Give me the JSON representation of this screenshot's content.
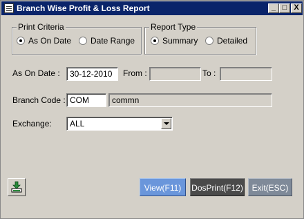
{
  "window": {
    "title": "Branch Wise Profit & Loss Report",
    "minimize": "_",
    "maximize": "□",
    "close": "X"
  },
  "print_criteria": {
    "legend": "Print Criteria",
    "options": [
      {
        "label": "As On Date",
        "selected": true
      },
      {
        "label": "Date Range",
        "selected": false
      }
    ]
  },
  "report_type": {
    "legend": "Report Type",
    "options": [
      {
        "label": "Summary",
        "selected": true
      },
      {
        "label": "Detailed",
        "selected": false
      }
    ]
  },
  "as_on_date": {
    "label": "As On Date :",
    "value": "30-12-2010"
  },
  "from": {
    "label": "From :",
    "value": ""
  },
  "to": {
    "label": "To :",
    "value": ""
  },
  "branch": {
    "label": "Branch Code :",
    "code": "COM",
    "name": "commn"
  },
  "exchange": {
    "label": "Exchange:",
    "value": "ALL"
  },
  "buttons": {
    "view": "View(F11)",
    "dosprint": "DosPrint(F12)",
    "exit": "Exit(ESC)"
  },
  "icons": {
    "download": "download-icon",
    "window": "app-window-icon"
  },
  "colors": {
    "title_bar": "#0a246a",
    "view_bg": "#6a96db",
    "dosprint_bg": "#4a4a4a",
    "exit_bg": "#7f8a99"
  }
}
